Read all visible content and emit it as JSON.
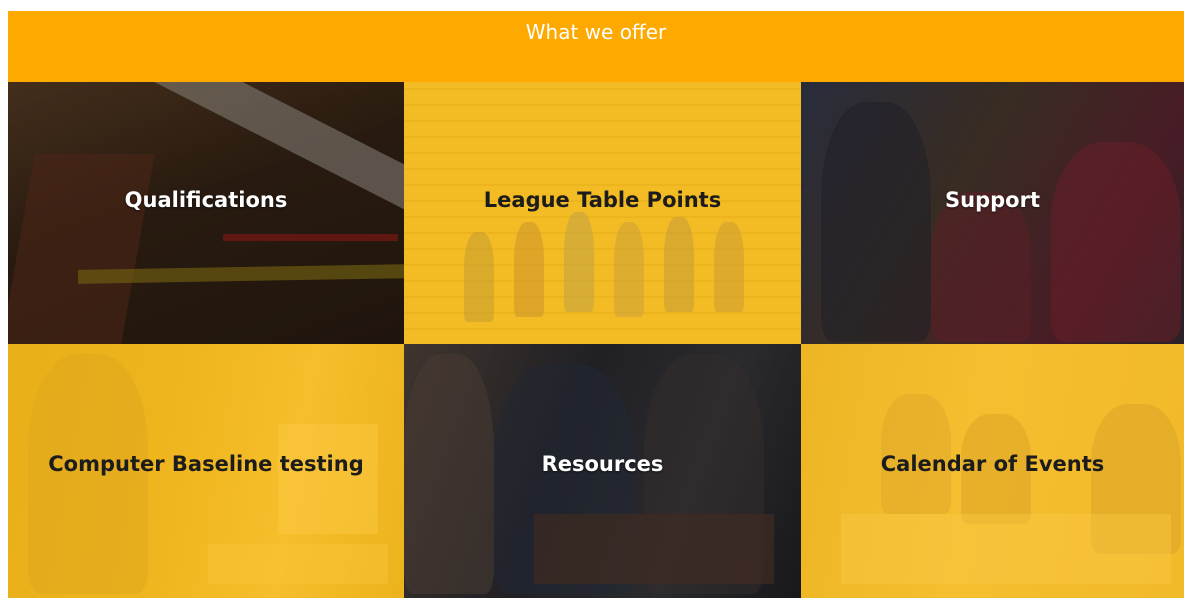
{
  "banner": {
    "title": "What we offer",
    "color": "#fda900"
  },
  "tiles": [
    {
      "label": "Qualifications",
      "style": "dark"
    },
    {
      "label": "League Table Points",
      "style": "yellow"
    },
    {
      "label": "Support",
      "style": "dark"
    },
    {
      "label": "Computer Baseline testing",
      "style": "yellow"
    },
    {
      "label": "Resources",
      "style": "dark"
    },
    {
      "label": "Calendar of Events",
      "style": "yellow"
    }
  ],
  "colors": {
    "accent": "#fda900",
    "overlay_yellow": "#fdbc12",
    "dark_label": "#ffffff",
    "yellow_label": "#1c1c1c"
  }
}
